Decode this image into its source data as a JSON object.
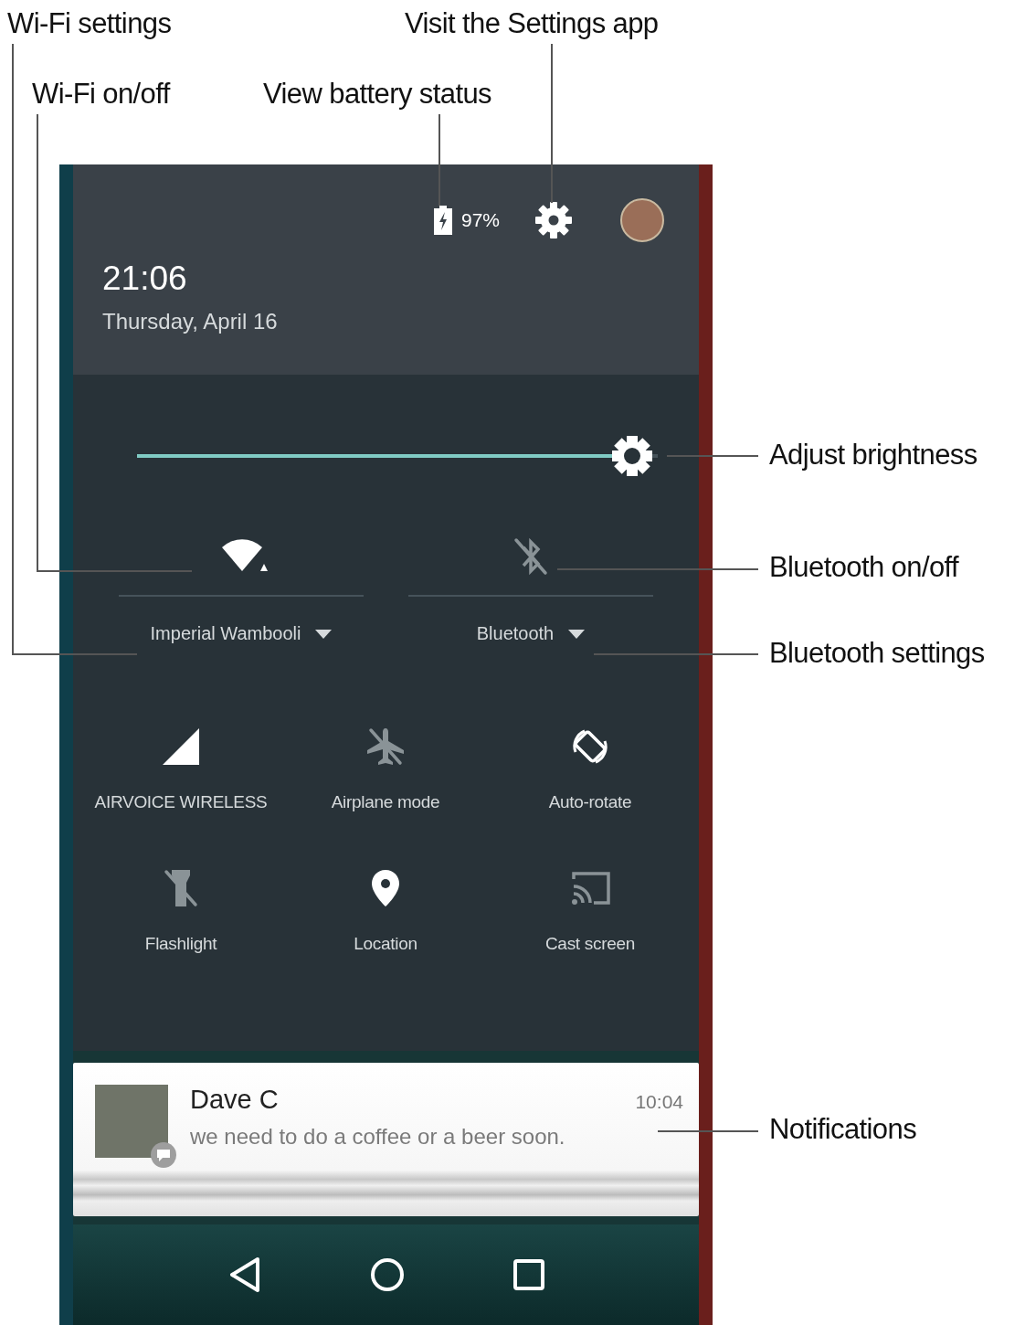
{
  "callouts": [
    {
      "text": "Wi-Fi settings"
    },
    {
      "text": "Visit the Settings app"
    },
    {
      "text": "Wi-Fi on/off"
    },
    {
      "text": "View battery status"
    },
    {
      "text": "Adjust brightness"
    },
    {
      "text": "Bluetooth on/off"
    },
    {
      "text": "Bluetooth settings"
    },
    {
      "text": "Notifications"
    }
  ],
  "header": {
    "battery": "97%",
    "time": "21:06",
    "date": "Thursday, April 16"
  },
  "brightness": {
    "level": 0.95
  },
  "toggles": [
    {
      "kind": "wifi",
      "label": "Imperial Wambooli",
      "on": true
    },
    {
      "kind": "bluetooth",
      "label": "Bluetooth",
      "on": false
    }
  ],
  "tiles": [
    {
      "kind": "cellular",
      "label": "AIRVOICE WIRELESS",
      "on": true
    },
    {
      "kind": "airplane",
      "label": "Airplane mode",
      "on": false
    },
    {
      "kind": "rotate",
      "label": "Auto-rotate",
      "on": true
    },
    {
      "kind": "flashlight",
      "label": "Flashlight",
      "on": false
    },
    {
      "kind": "location",
      "label": "Location",
      "on": true
    },
    {
      "kind": "cast",
      "label": "Cast screen",
      "on": false
    }
  ],
  "notification": {
    "title": "Dave C",
    "time": "10:04",
    "text": "we need to do a coffee or a beer soon."
  }
}
